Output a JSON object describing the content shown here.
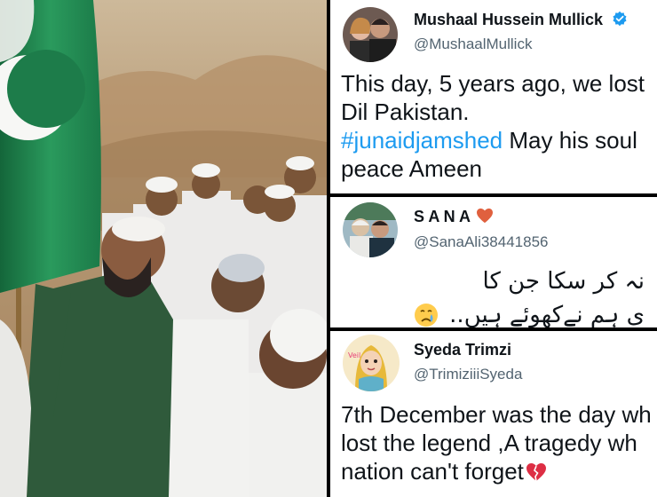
{
  "photo": {
    "description_icon": "photo-icon"
  },
  "tweets": [
    {
      "name": "Mushaal Hussein Mullick",
      "handle": "@MushaalMullick",
      "verified": true,
      "line1": "This day, 5 years ago, we lost",
      "line2": "Dil Pakistan.",
      "hashtag": "#junaidjamshed",
      "line3_rest": " May his soul",
      "line4": "peace Ameen"
    },
    {
      "name": "S A N A",
      "handle": "@SanaAli38441856",
      "urdu_line1": "نہ کر سکا جن کا",
      "urdu_line2": "ی ہم نےکھوئے ہیں..",
      "emoji_icon": "crying-face-icon"
    },
    {
      "name": "Syeda Trimzi",
      "handle": "@TrimiziiiSyeda",
      "line1": "7th December was the day wh",
      "line2": "lost the legend ,A tragedy wh",
      "line3": "nation can't forget",
      "emoji_icon": "broken-heart-icon"
    }
  ],
  "colors": {
    "twitter_blue": "#1d9bf0",
    "text": "#0f1419",
    "muted": "#536471",
    "flag_green": "#1e7d4c"
  }
}
